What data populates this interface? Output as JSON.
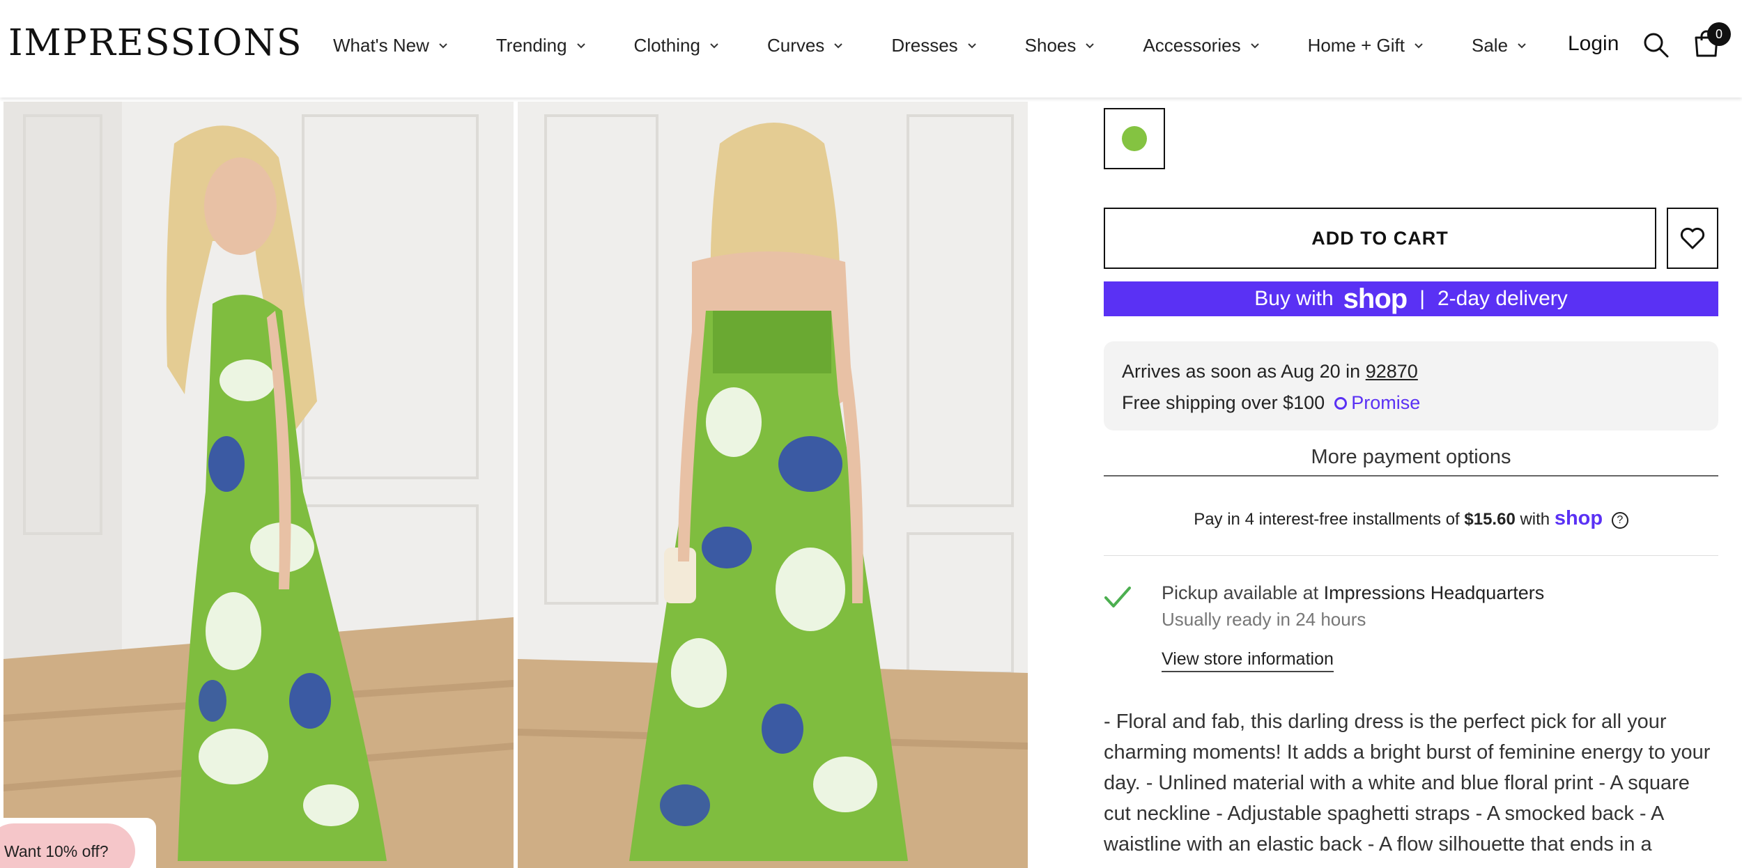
{
  "header": {
    "logo": "IMPRESSIONS",
    "nav": [
      "What's New",
      "Trending",
      "Clothing",
      "Curves",
      "Dresses",
      "Shoes",
      "Accessories",
      "Home + Gift",
      "Sale"
    ],
    "login": "Login",
    "cart_count": "0"
  },
  "product": {
    "swatch_color": "#84c341",
    "add_to_cart": "ADD TO CART",
    "shop_pay": {
      "prefix": "Buy with",
      "brand": "shop",
      "separator": "|",
      "suffix": "2-day delivery"
    },
    "delivery": {
      "arrives_prefix": "Arrives as soon as Aug 20 in",
      "zip": "92870",
      "shipping": "Free shipping over $100",
      "promise": "Promise"
    },
    "more_payment": "More payment options",
    "installments": {
      "text": "Pay in 4 interest-free installments of",
      "amount": "$15.60",
      "with": "with",
      "brand": "shop"
    },
    "pickup": {
      "prefix": "Pickup available at",
      "store": "Impressions Headquarters",
      "ready": "Usually ready in 24 hours",
      "link": "View store information"
    },
    "description": "- Floral and fab, this darling dress is the perfect pick for all your charming moments! It adds a bright burst of feminine energy to your day. - Unlined material with a white and blue floral print - A square cut neckline - Adjustable spaghetti straps - A smocked back - A waistline with an elastic back - A flow silhouette that ends in a"
  },
  "promo": {
    "label": "Want 10% off?"
  },
  "colors": {
    "shop_purple": "#5a31f4",
    "dress_green": "#84c341",
    "check_green": "#4caf50",
    "promo_pink": "#f5c6c9"
  }
}
